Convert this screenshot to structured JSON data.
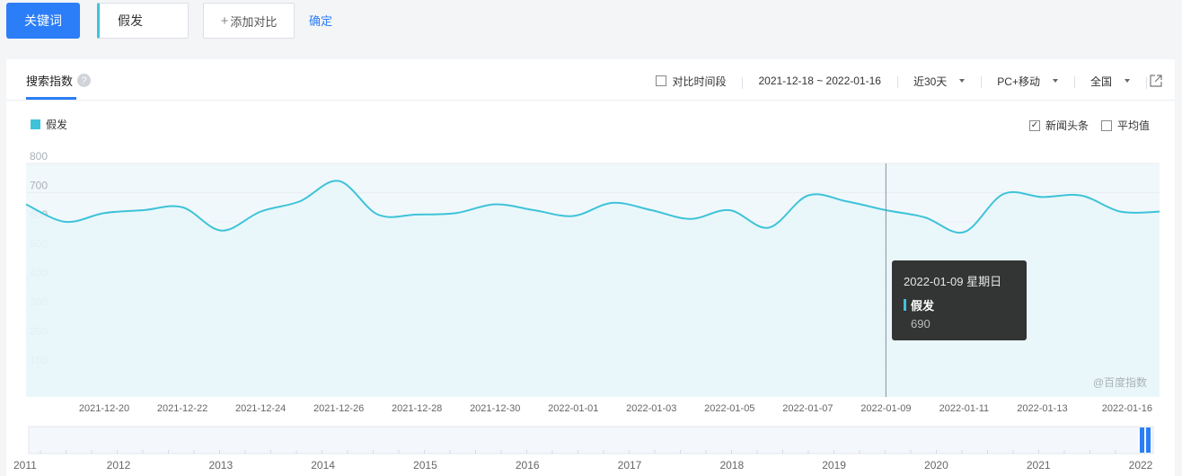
{
  "topbar": {
    "keyword_button": "关键词",
    "keyword_value": "假发",
    "add_compare": "添加对比",
    "add_compare_plus": "+",
    "confirm": "确定"
  },
  "card": {
    "tab_title": "搜索指数",
    "help_mark": "?",
    "controls": {
      "compare_period": "对比时间段",
      "date_range": "2021-12-18 ~ 2022-01-16",
      "period_select": "近30天",
      "device_select": "PC+移动",
      "region_select": "全国"
    },
    "options": {
      "news_label": "新闻头条",
      "news_checked": "✓",
      "avg_label": "平均值"
    },
    "watermark": "@百度指数"
  },
  "tooltip": {
    "date": "2022-01-09 星期日",
    "series": "假发",
    "value": "690"
  },
  "colors": {
    "line": "#3ec3d8",
    "accent": "#2b7ef7"
  },
  "chart_data": {
    "type": "area",
    "x": [
      "2021-12-18",
      "2021-12-19",
      "2021-12-20",
      "2021-12-21",
      "2021-12-22",
      "2021-12-23",
      "2021-12-24",
      "2021-12-25",
      "2021-12-26",
      "2021-12-27",
      "2021-12-28",
      "2021-12-29",
      "2021-12-30",
      "2021-12-31",
      "2022-01-01",
      "2022-01-02",
      "2022-01-03",
      "2022-01-04",
      "2022-01-05",
      "2022-01-06",
      "2022-01-07",
      "2022-01-08",
      "2022-01-09",
      "2022-01-10",
      "2022-01-11",
      "2022-01-12",
      "2022-01-13",
      "2022-01-14",
      "2022-01-15",
      "2022-01-16"
    ],
    "x_tick_labels": [
      "2021-12-20",
      "2021-12-22",
      "2021-12-24",
      "2021-12-26",
      "2021-12-28",
      "2021-12-30",
      "2022-01-01",
      "2022-01-03",
      "2022-01-05",
      "2022-01-07",
      "2022-01-09",
      "2022-01-11",
      "2022-01-13",
      "2022-01-16"
    ],
    "series": [
      {
        "name": "假发",
        "values": [
          660,
          600,
          630,
          640,
          650,
          570,
          635,
          670,
          740,
          625,
          625,
          630,
          660,
          640,
          620,
          665,
          640,
          610,
          640,
          580,
          690,
          670,
          640,
          615,
          565,
          695,
          685,
          690,
          635,
          635
        ]
      }
    ],
    "y_ticks": [
      100,
      200,
      300,
      400,
      500,
      600,
      700,
      800
    ],
    "ylim": [
      0,
      800
    ],
    "grid": true,
    "overview_year_labels": [
      "2011",
      "2012",
      "2013",
      "2014",
      "2015",
      "2016",
      "2017",
      "2018",
      "2019",
      "2020",
      "2021",
      "2022"
    ]
  }
}
